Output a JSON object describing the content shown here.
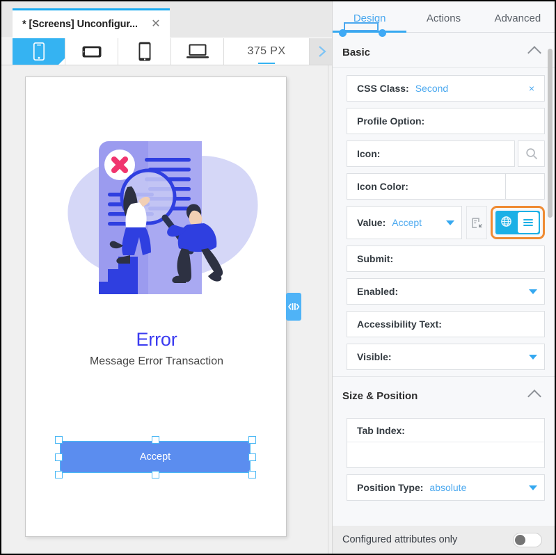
{
  "window": {
    "tab": {
      "label": "* [Screens] Unconfigur...",
      "close_icon": "close-icon"
    }
  },
  "device_toolbar": {
    "devices": [
      {
        "name": "phone-portrait",
        "icon": "phone-portrait-icon",
        "active": true
      },
      {
        "name": "phone-landscape",
        "icon": "phone-landscape-icon",
        "active": false
      },
      {
        "name": "tablet-portrait",
        "icon": "tablet-portrait-icon",
        "active": false
      },
      {
        "name": "laptop",
        "icon": "laptop-icon",
        "active": false
      }
    ],
    "zoom_value": "375 PX",
    "next_icon": "chevron-right-icon"
  },
  "canvas": {
    "illustration": "error-search-illustration",
    "error_title": "Error",
    "error_subtitle": "Message Error Transaction",
    "accept_button": "Accept",
    "splitter_icon": "collapse-splitter-icon"
  },
  "panel": {
    "tabs": [
      {
        "label": "Design",
        "active": true
      },
      {
        "label": "Actions",
        "active": false
      },
      {
        "label": "Advanced",
        "active": false
      }
    ],
    "sections": [
      {
        "title": "Basic",
        "collapse_icon": "chevron-up-icon"
      },
      {
        "title": "Size & Position",
        "collapse_icon": "chevron-up-icon"
      }
    ],
    "basic_fields": {
      "css_class": {
        "label": "CSS Class:",
        "value": "Second",
        "clear": "×"
      },
      "profile_option": {
        "label": "Profile Option:",
        "value": ""
      },
      "icon": {
        "label": "Icon:",
        "value": "",
        "button_icon": "search-icon"
      },
      "icon_color": {
        "label": "Icon Color:",
        "value": ""
      },
      "value": {
        "label": "Value:",
        "value": "Accept",
        "caret_icon": "chevron-down-icon",
        "expression_icon": "expression-editor-icon",
        "segmented": [
          {
            "name": "translate-globe-icon",
            "selected": false
          },
          {
            "name": "list-lines-icon",
            "selected": true
          }
        ]
      },
      "submit": {
        "label": "Submit:",
        "value": ""
      },
      "enabled": {
        "label": "Enabled:",
        "value": "",
        "caret_icon": "chevron-down-icon"
      },
      "accessibility_text": {
        "label": "Accessibility Text:",
        "value": ""
      },
      "visible": {
        "label": "Visible:",
        "value": "",
        "caret_icon": "chevron-down-icon"
      }
    },
    "size_position_fields": {
      "tab_index": {
        "label": "Tab Index:",
        "value": ""
      },
      "position_type": {
        "label": "Position Type:",
        "value": "absolute",
        "caret_icon": "chevron-down-icon"
      }
    },
    "footer": {
      "label": "Configured attributes only",
      "toggle_on": false
    }
  },
  "colors": {
    "accent_blue": "#35a8f0",
    "highlight_orange": "#ef8b33",
    "segment_cyan": "#1cb0e6",
    "accept_button": "#5b8def",
    "error_text": "#3b3bf0",
    "selection_handle": "#4ab8f5"
  }
}
